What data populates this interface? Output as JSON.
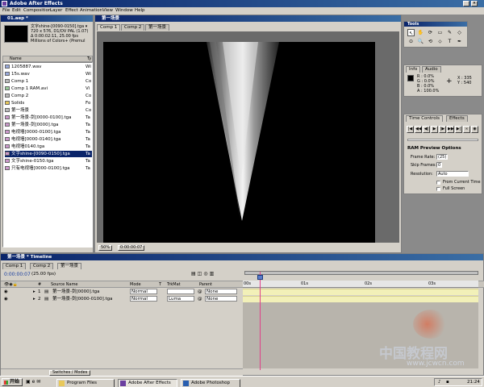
{
  "app": {
    "title": "Adobe After Effects",
    "menu": [
      "File",
      "Edit",
      "Composition",
      "Layer",
      "Effect",
      "Animation",
      "View",
      "Window",
      "Help"
    ]
  },
  "project": {
    "window_title": "01.aep *",
    "thumb_info": [
      "文字shine-[0090-0150].tga ▾",
      "720 x 576, D1/DV PAL (1.07)",
      "Δ 0:00:02:11, 25.00 fps",
      "Millions of Colors+ (Premul"
    ],
    "col_name": "Name",
    "col_type": "Ty",
    "items": [
      {
        "name": "1205887.wav",
        "type": "Wi",
        "icon": "audio-icon"
      },
      {
        "name": "15s.wav",
        "type": "Wi",
        "icon": "audio-icon"
      },
      {
        "name": "Comp 1",
        "type": "Co",
        "icon": "comp-icon"
      },
      {
        "name": "Comp 1 RAM.avi",
        "type": "Vi",
        "icon": "video-icon"
      },
      {
        "name": "Comp 2",
        "type": "Co",
        "icon": "comp-icon"
      },
      {
        "name": "Solids",
        "type": "Fo",
        "icon": "folder-icon"
      },
      {
        "name": "第一场景",
        "type": "Co",
        "icon": "comp-icon"
      },
      {
        "name": "第一场景-剑[0000-0100].tga",
        "type": "Ta",
        "icon": "footage-icon"
      },
      {
        "name": "第一场景-剑[0000].tga",
        "type": "Ta",
        "icon": "footage-icon"
      },
      {
        "name": "电视墙[0000-0100].tga",
        "type": "Ta",
        "icon": "footage-icon"
      },
      {
        "name": "电视墙[0000-0140].tga",
        "type": "Ta",
        "icon": "footage-icon"
      },
      {
        "name": "电视墙0140.tga",
        "type": "Ta",
        "icon": "footage-icon"
      },
      {
        "name": "文字shine-[0090-0150].tga",
        "type": "Ta",
        "icon": "footage-icon",
        "selected": true
      },
      {
        "name": "文字shine-0150.tga",
        "type": "Ta",
        "icon": "footage-icon"
      },
      {
        "name": "只有电视墙[0000-0100].tga",
        "type": "Ta",
        "icon": "footage-icon"
      }
    ]
  },
  "composition": {
    "window_title": "第一场景",
    "tabs": [
      "Comp 1",
      "Comp 2",
      "第一场景"
    ],
    "zoom": "50%",
    "timecode": "0:00:00:07"
  },
  "tools": {
    "title": "Tools",
    "glyphs": [
      "↖",
      "✋",
      "⟳",
      "▭",
      "✎",
      "◇",
      "⊙",
      "🔍",
      "⟲",
      "⬦",
      "T",
      "✒"
    ]
  },
  "info": {
    "tabs": [
      "Info",
      "Audio"
    ],
    "r_label": "R :",
    "r_value": "0.0%",
    "g_label": "G :",
    "g_value": "0.0%",
    "b_label": "B :",
    "b_value": "0.0%",
    "a_label": "A :",
    "a_value": "100.0%",
    "x_label": "X :",
    "x_value": "335",
    "y_label": "Y :",
    "y_value": "540"
  },
  "time_controls": {
    "tabs": [
      "Time Controls",
      "Effects"
    ],
    "buttons": [
      "|◀",
      "◀◀",
      "◀|",
      "▶",
      "|▶",
      "▶▶",
      "▶|",
      "∞",
      "◉"
    ],
    "ram_title": "RAM Preview Options",
    "frame_rate_label": "Frame Rate:",
    "frame_rate_value": "(25)",
    "skip_label": "Skip Frames:",
    "skip_value": "0",
    "res_label": "Resolution:",
    "res_value": "Auto",
    "from_current": "From Current Time",
    "full_screen": "Full Screen"
  },
  "timeline": {
    "window_title": "第一场景 * Timeline",
    "tabs": [
      "Comp 1",
      "Comp 2",
      "第一场景"
    ],
    "timecode": "0:00:00:07",
    "fps": "(25.00 fps)",
    "headers": {
      "num": "#",
      "source": "Source Name",
      "mode": "Mode",
      "t": "T",
      "trkmat": "TrkMat",
      "parent": "Parent"
    },
    "ruler": [
      "00s",
      "01s",
      "02s",
      "03s"
    ],
    "layers": [
      {
        "num": "1",
        "name": "第一场景-剑[0000].tga",
        "mode": "Normal",
        "trkmat": "",
        "parent": "None"
      },
      {
        "num": "2",
        "name": "第一场景-剑[0000-0100].tga",
        "mode": "Normal",
        "trkmat": "Luma",
        "parent": "None"
      }
    ],
    "footer": "Switches / Modes"
  },
  "taskbar": {
    "start": "开始",
    "items": [
      "Program Files",
      "Adobe After Effects",
      "Adobe Photoshop"
    ],
    "clock": "21:24"
  },
  "watermark": {
    "cn": "中国教程网",
    "url": "www.jcwcn.com"
  },
  "colors": {
    "titlebar": "#0a246a",
    "panel": "#d4d0c8",
    "desktop": "#3a5fa8",
    "playhead": "#e0408a",
    "layer_bar": "#f2f0b8"
  }
}
